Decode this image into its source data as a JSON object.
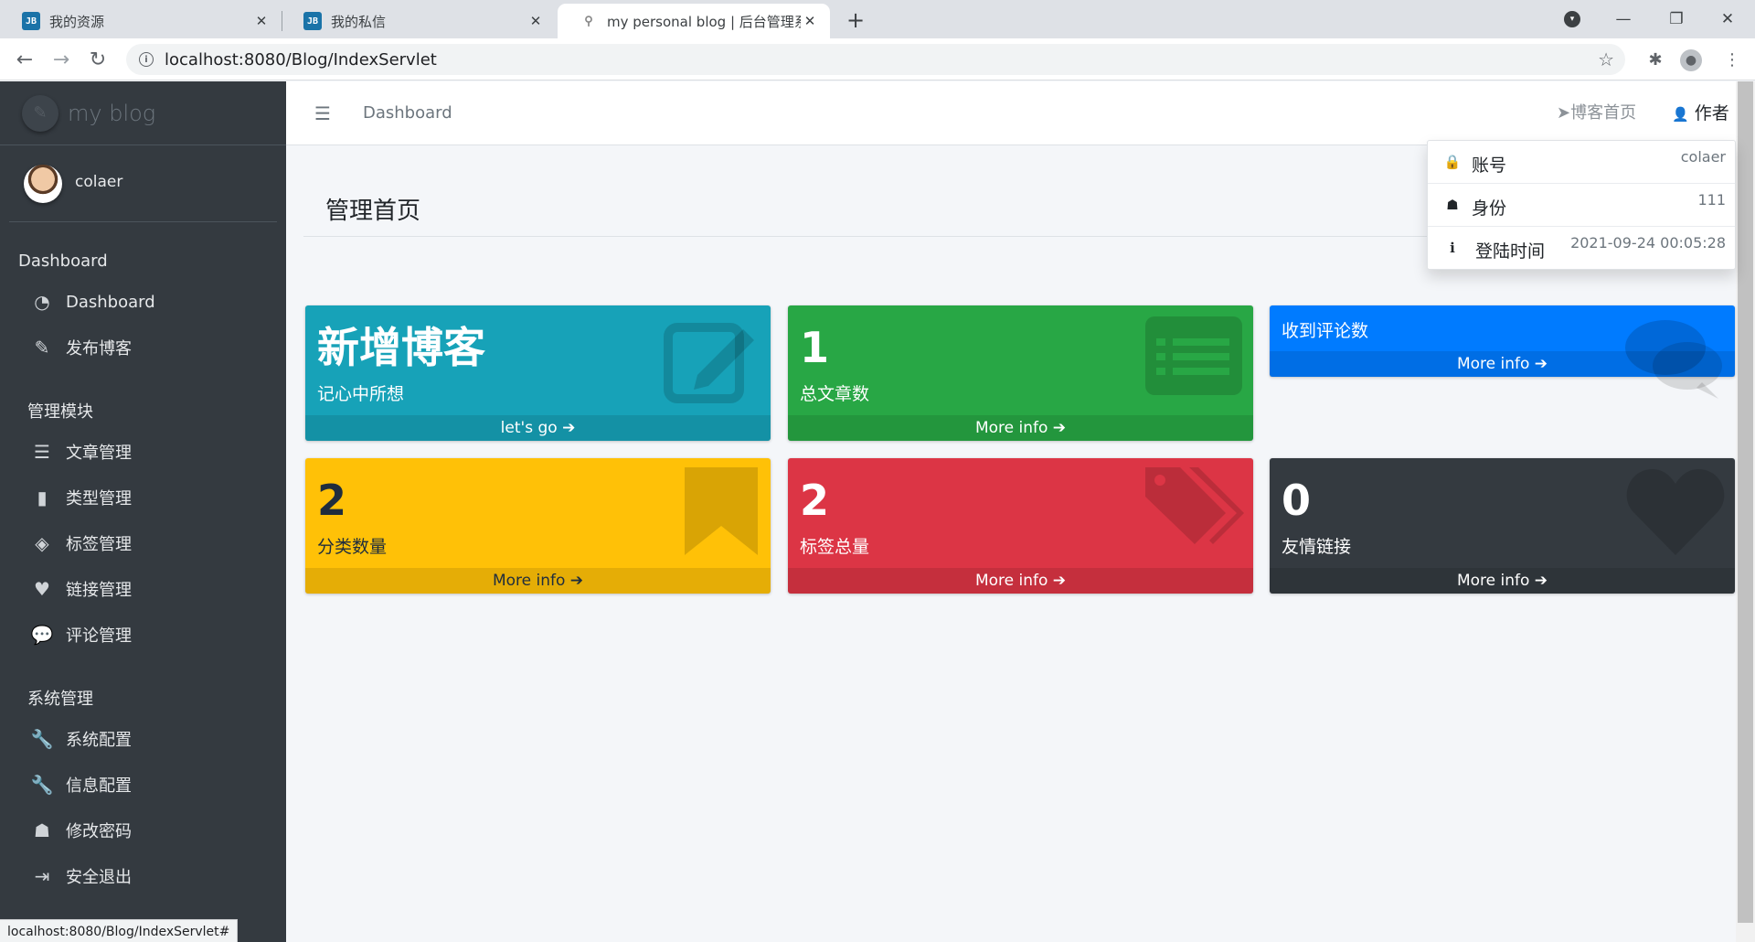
{
  "browser": {
    "tabs": [
      {
        "title": "我的资源",
        "icon": "jb-icon"
      },
      {
        "title": "我的私信",
        "icon": "jb-icon"
      },
      {
        "title": "my personal blog | 后台管理系",
        "icon": "blog-icon"
      }
    ],
    "url": "localhost:8080/Blog/IndexServlet",
    "status_url": "localhost:8080/Blog/IndexServlet#"
  },
  "sidebar": {
    "brand": "my blog",
    "user": "colaer",
    "sections": [
      {
        "header": "Dashboard",
        "items": [
          {
            "label": "Dashboard",
            "icon": "tachometer-icon"
          },
          {
            "label": "发布博客",
            "icon": "edit-icon"
          }
        ]
      },
      {
        "header": "管理模块",
        "items": [
          {
            "label": "文章管理",
            "icon": "list-icon"
          },
          {
            "label": "类型管理",
            "icon": "bookmark-icon"
          },
          {
            "label": "标签管理",
            "icon": "tags-icon"
          },
          {
            "label": "链接管理",
            "icon": "heart-icon"
          },
          {
            "label": "评论管理",
            "icon": "comments-icon"
          }
        ]
      },
      {
        "header": "系统管理",
        "items": [
          {
            "label": "系统配置",
            "icon": "wrench-icon"
          },
          {
            "label": "信息配置",
            "icon": "wrench-icon"
          },
          {
            "label": "修改密码",
            "icon": "user-secret-icon"
          },
          {
            "label": "安全退出",
            "icon": "sign-out-icon"
          }
        ]
      }
    ]
  },
  "topnav": {
    "breadcrumb": "Dashboard",
    "blog_home_link": "博客首页",
    "author": "作者"
  },
  "content": {
    "title": "管理首页"
  },
  "boxes": {
    "new_blog": {
      "title": "新增博客",
      "sub": "记心中所想",
      "link": "let's go"
    },
    "articles": {
      "value": "1",
      "sub": "总文章数",
      "link": "More info"
    },
    "comments": {
      "sub": "收到评论数",
      "link": "More info"
    },
    "categories": {
      "value": "2",
      "sub": "分类数量",
      "link": "More info"
    },
    "tags": {
      "value": "2",
      "sub": "标签总量",
      "link": "More info"
    },
    "links": {
      "value": "0",
      "sub": "友情链接",
      "link": "More info"
    }
  },
  "dropdown": {
    "account_label": "账号",
    "account_value": "colaer",
    "role_label": "身份",
    "role_value": "111",
    "login_label": "登陆时间",
    "login_value": "2021-09-24 00:05:28"
  },
  "colors": {
    "info": "#17a2b8",
    "success": "#28a745",
    "primary": "#007bff",
    "warning": "#ffc107",
    "danger": "#dc3545",
    "dark": "#343a40"
  }
}
